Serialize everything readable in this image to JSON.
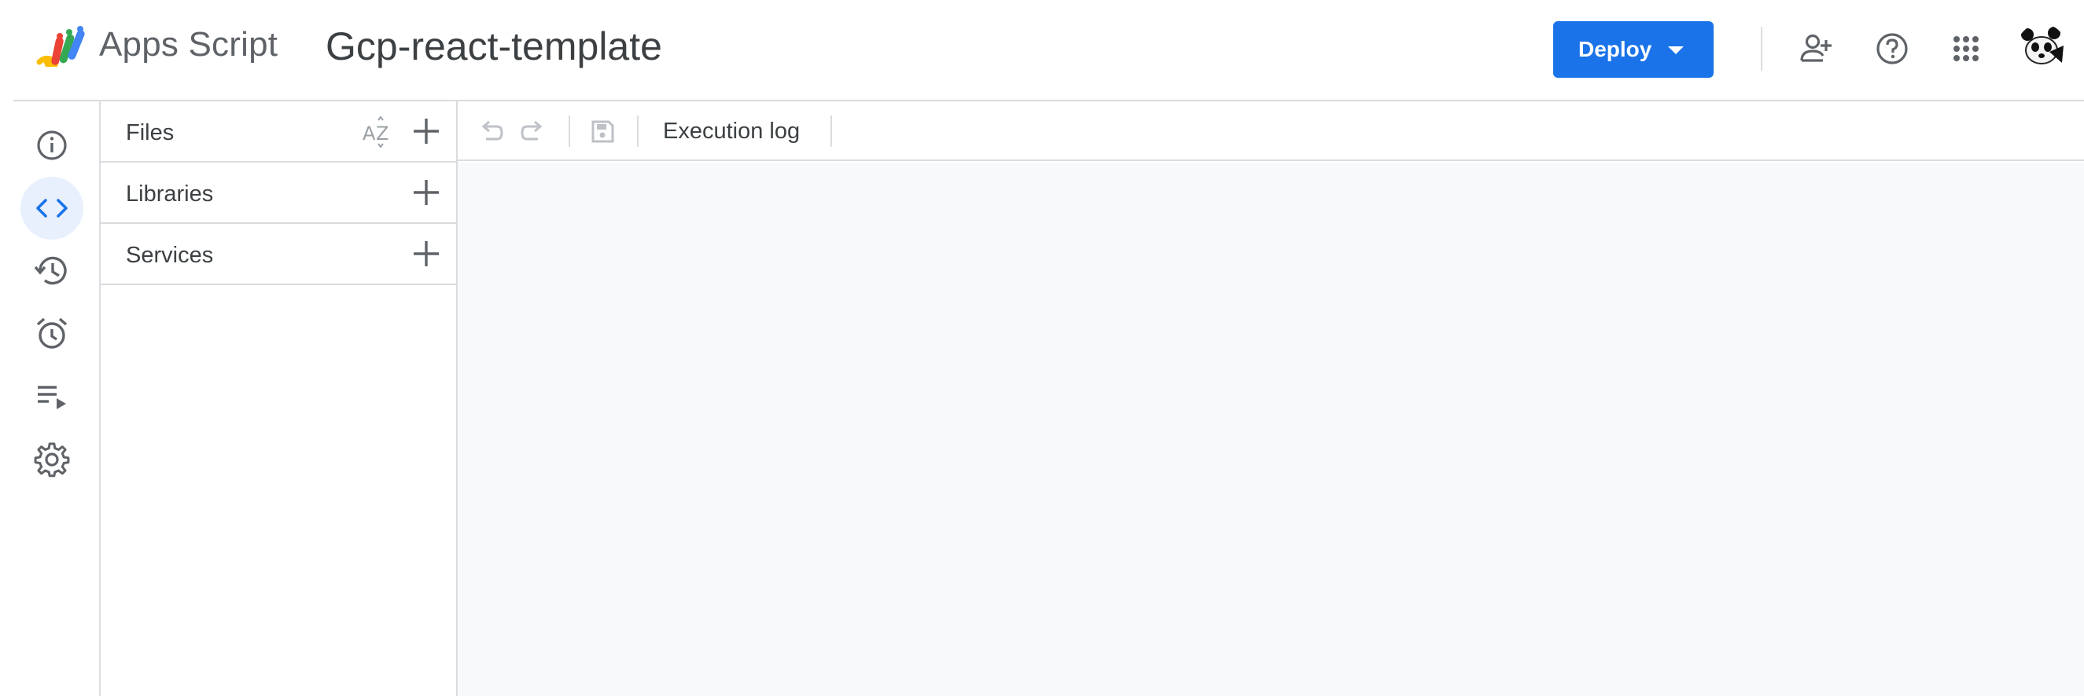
{
  "app": {
    "name": "Apps Script",
    "project_title": "Gcp-react-template",
    "logo_icon": "apps-script-logo"
  },
  "header": {
    "deploy_label": "Deploy",
    "deploy_color": "#1a73e8",
    "icons": [
      "add-person-icon",
      "help-icon",
      "apps-grid-icon"
    ],
    "avatar_icon": "panda-avatar"
  },
  "nav": {
    "items": [
      {
        "name": "overview",
        "icon": "info-icon",
        "active": false
      },
      {
        "name": "editor",
        "icon": "code-icon",
        "active": true
      },
      {
        "name": "project-history",
        "icon": "history-icon",
        "active": false
      },
      {
        "name": "triggers",
        "icon": "alarm-icon",
        "active": false
      },
      {
        "name": "executions",
        "icon": "playlist-play-icon",
        "active": false
      },
      {
        "name": "project-settings",
        "icon": "gear-icon",
        "active": false
      }
    ],
    "accent": "#1a73e8",
    "active_bg": "#e8f0fe"
  },
  "panel": {
    "files_label": "Files",
    "sort_icon": "sort-az-icon",
    "libraries_label": "Libraries",
    "services_label": "Services"
  },
  "toolbar": {
    "icons": [
      "undo-icon",
      "redo-icon",
      "save-icon"
    ],
    "execution_log_label": "Execution log"
  }
}
